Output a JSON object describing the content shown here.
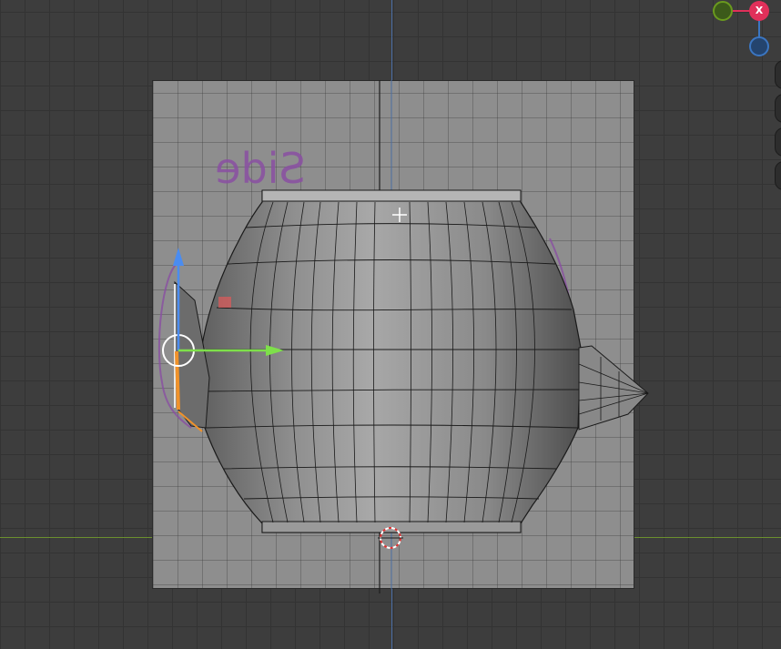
{
  "viewport": {
    "background": "#3d3d3d",
    "reference_label": "Side",
    "reference_color": "#8a4fa3"
  },
  "nav_gizmo": {
    "x_axis_label": "X",
    "x_color": "#e0305a",
    "y_color": "#6a9a1e",
    "z_color": "#3b76c2"
  },
  "transform_gizmo": {
    "move_x_color": "#7ee04a",
    "move_z_color": "#4a8cf0",
    "selection_color": "#f0922a"
  },
  "icons": [
    "cursor-crosshair-icon",
    "3d-cursor-icon",
    "navigation-gizmo",
    "transform-gizmo"
  ]
}
